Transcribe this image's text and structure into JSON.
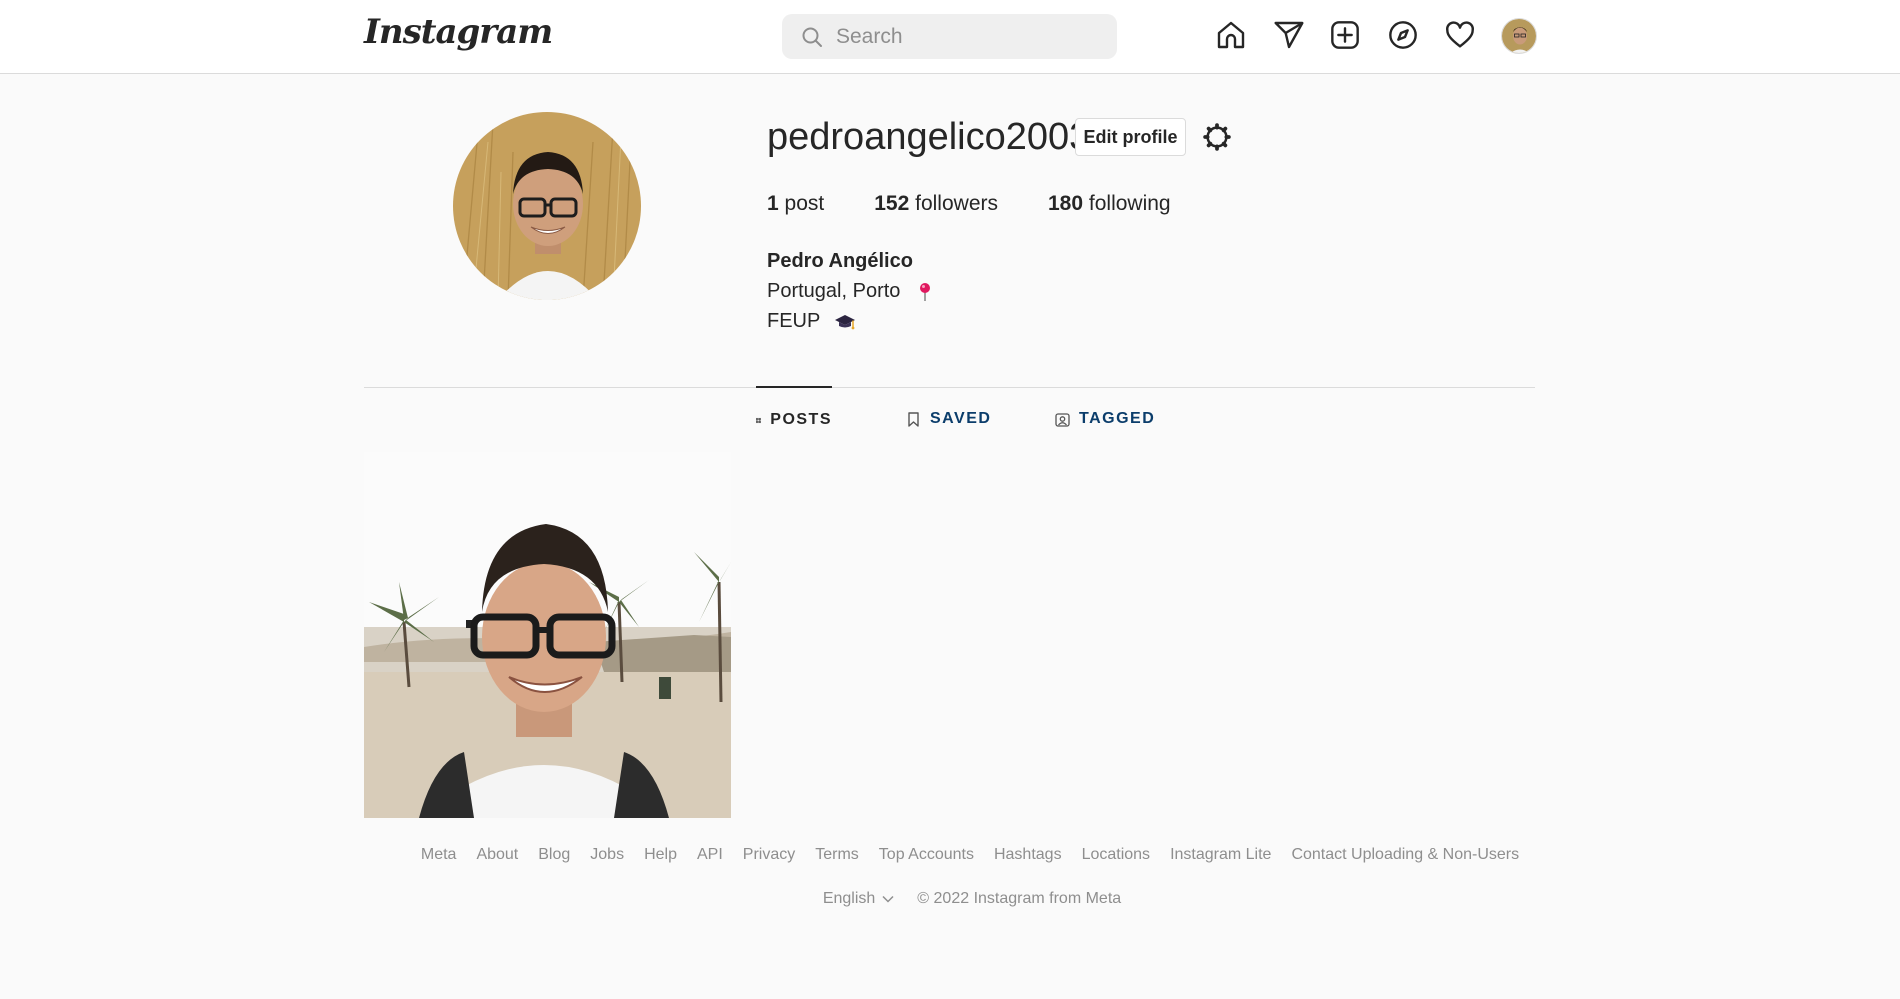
{
  "header": {
    "logo": "Instagram",
    "search_placeholder": "Search",
    "nav_icons": [
      "home-icon",
      "direct-message-icon",
      "new-post-icon",
      "explore-icon",
      "activity-heart-icon",
      "profile-avatar"
    ]
  },
  "profile": {
    "username": "pedroangelico2003",
    "edit_label": "Edit profile",
    "posts_count": "1",
    "posts_label": "post",
    "followers_count": "152",
    "followers_label": "followers",
    "following_count": "180",
    "following_label": "following",
    "full_name": "Pedro Angélico",
    "bio_line1": "Portugal, Porto",
    "bio_line2": "FEUP"
  },
  "tabs": [
    {
      "label": "POSTS",
      "active": true
    },
    {
      "label": "SAVED",
      "active": false
    },
    {
      "label": "TAGGED",
      "active": false
    }
  ],
  "footer": {
    "links": [
      "Meta",
      "About",
      "Blog",
      "Jobs",
      "Help",
      "API",
      "Privacy",
      "Terms",
      "Top Accounts",
      "Hashtags",
      "Locations",
      "Instagram Lite",
      "Contact Uploading & Non-Users"
    ],
    "language": "English",
    "copyright": "© 2022 Instagram from Meta"
  },
  "colors": {
    "background": "#fafafa",
    "border": "#dbdbdb",
    "text": "#262626",
    "muted": "#8e8e8e",
    "tab_inactive": "#0b3d6b"
  }
}
